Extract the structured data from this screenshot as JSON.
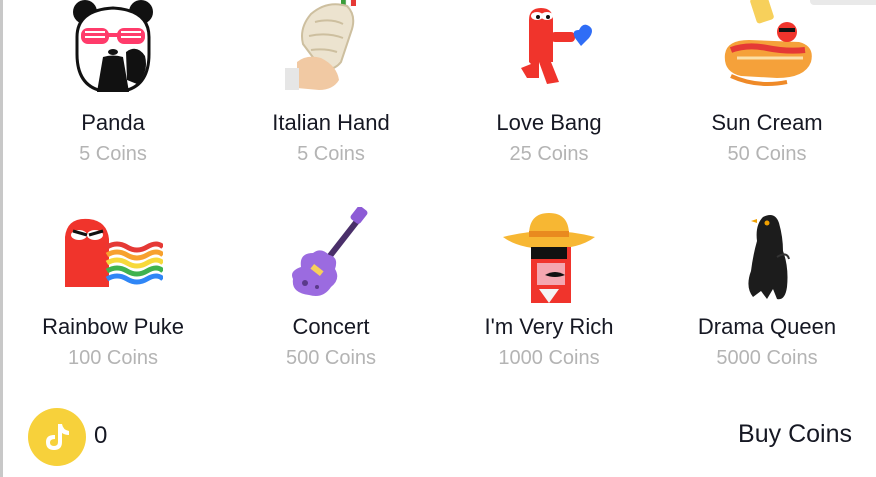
{
  "gifts": [
    {
      "name": "Panda",
      "price": "5 Coins",
      "icon": "panda-icon"
    },
    {
      "name": "Italian Hand",
      "price": "5 Coins",
      "icon": "italian-hand-icon"
    },
    {
      "name": "Love Bang",
      "price": "25 Coins",
      "icon": "love-bang-icon"
    },
    {
      "name": "Sun Cream",
      "price": "50 Coins",
      "icon": "sun-cream-icon"
    },
    {
      "name": "Rainbow Puke",
      "price": "100 Coins",
      "icon": "rainbow-puke-icon"
    },
    {
      "name": "Concert",
      "price": "500 Coins",
      "icon": "guitar-icon"
    },
    {
      "name": "I'm Very Rich",
      "price": "1000 Coins",
      "icon": "very-rich-icon"
    },
    {
      "name": "Drama Queen",
      "price": "5000 Coins",
      "icon": "drama-queen-icon"
    }
  ],
  "wallet": {
    "icon": "tiktok-coin-icon",
    "balance": "0",
    "buy_label": "Buy Coins"
  },
  "colors": {
    "coin_yellow": "#f7d13b",
    "text_dark": "#161823",
    "text_muted": "#b4b4b4"
  }
}
